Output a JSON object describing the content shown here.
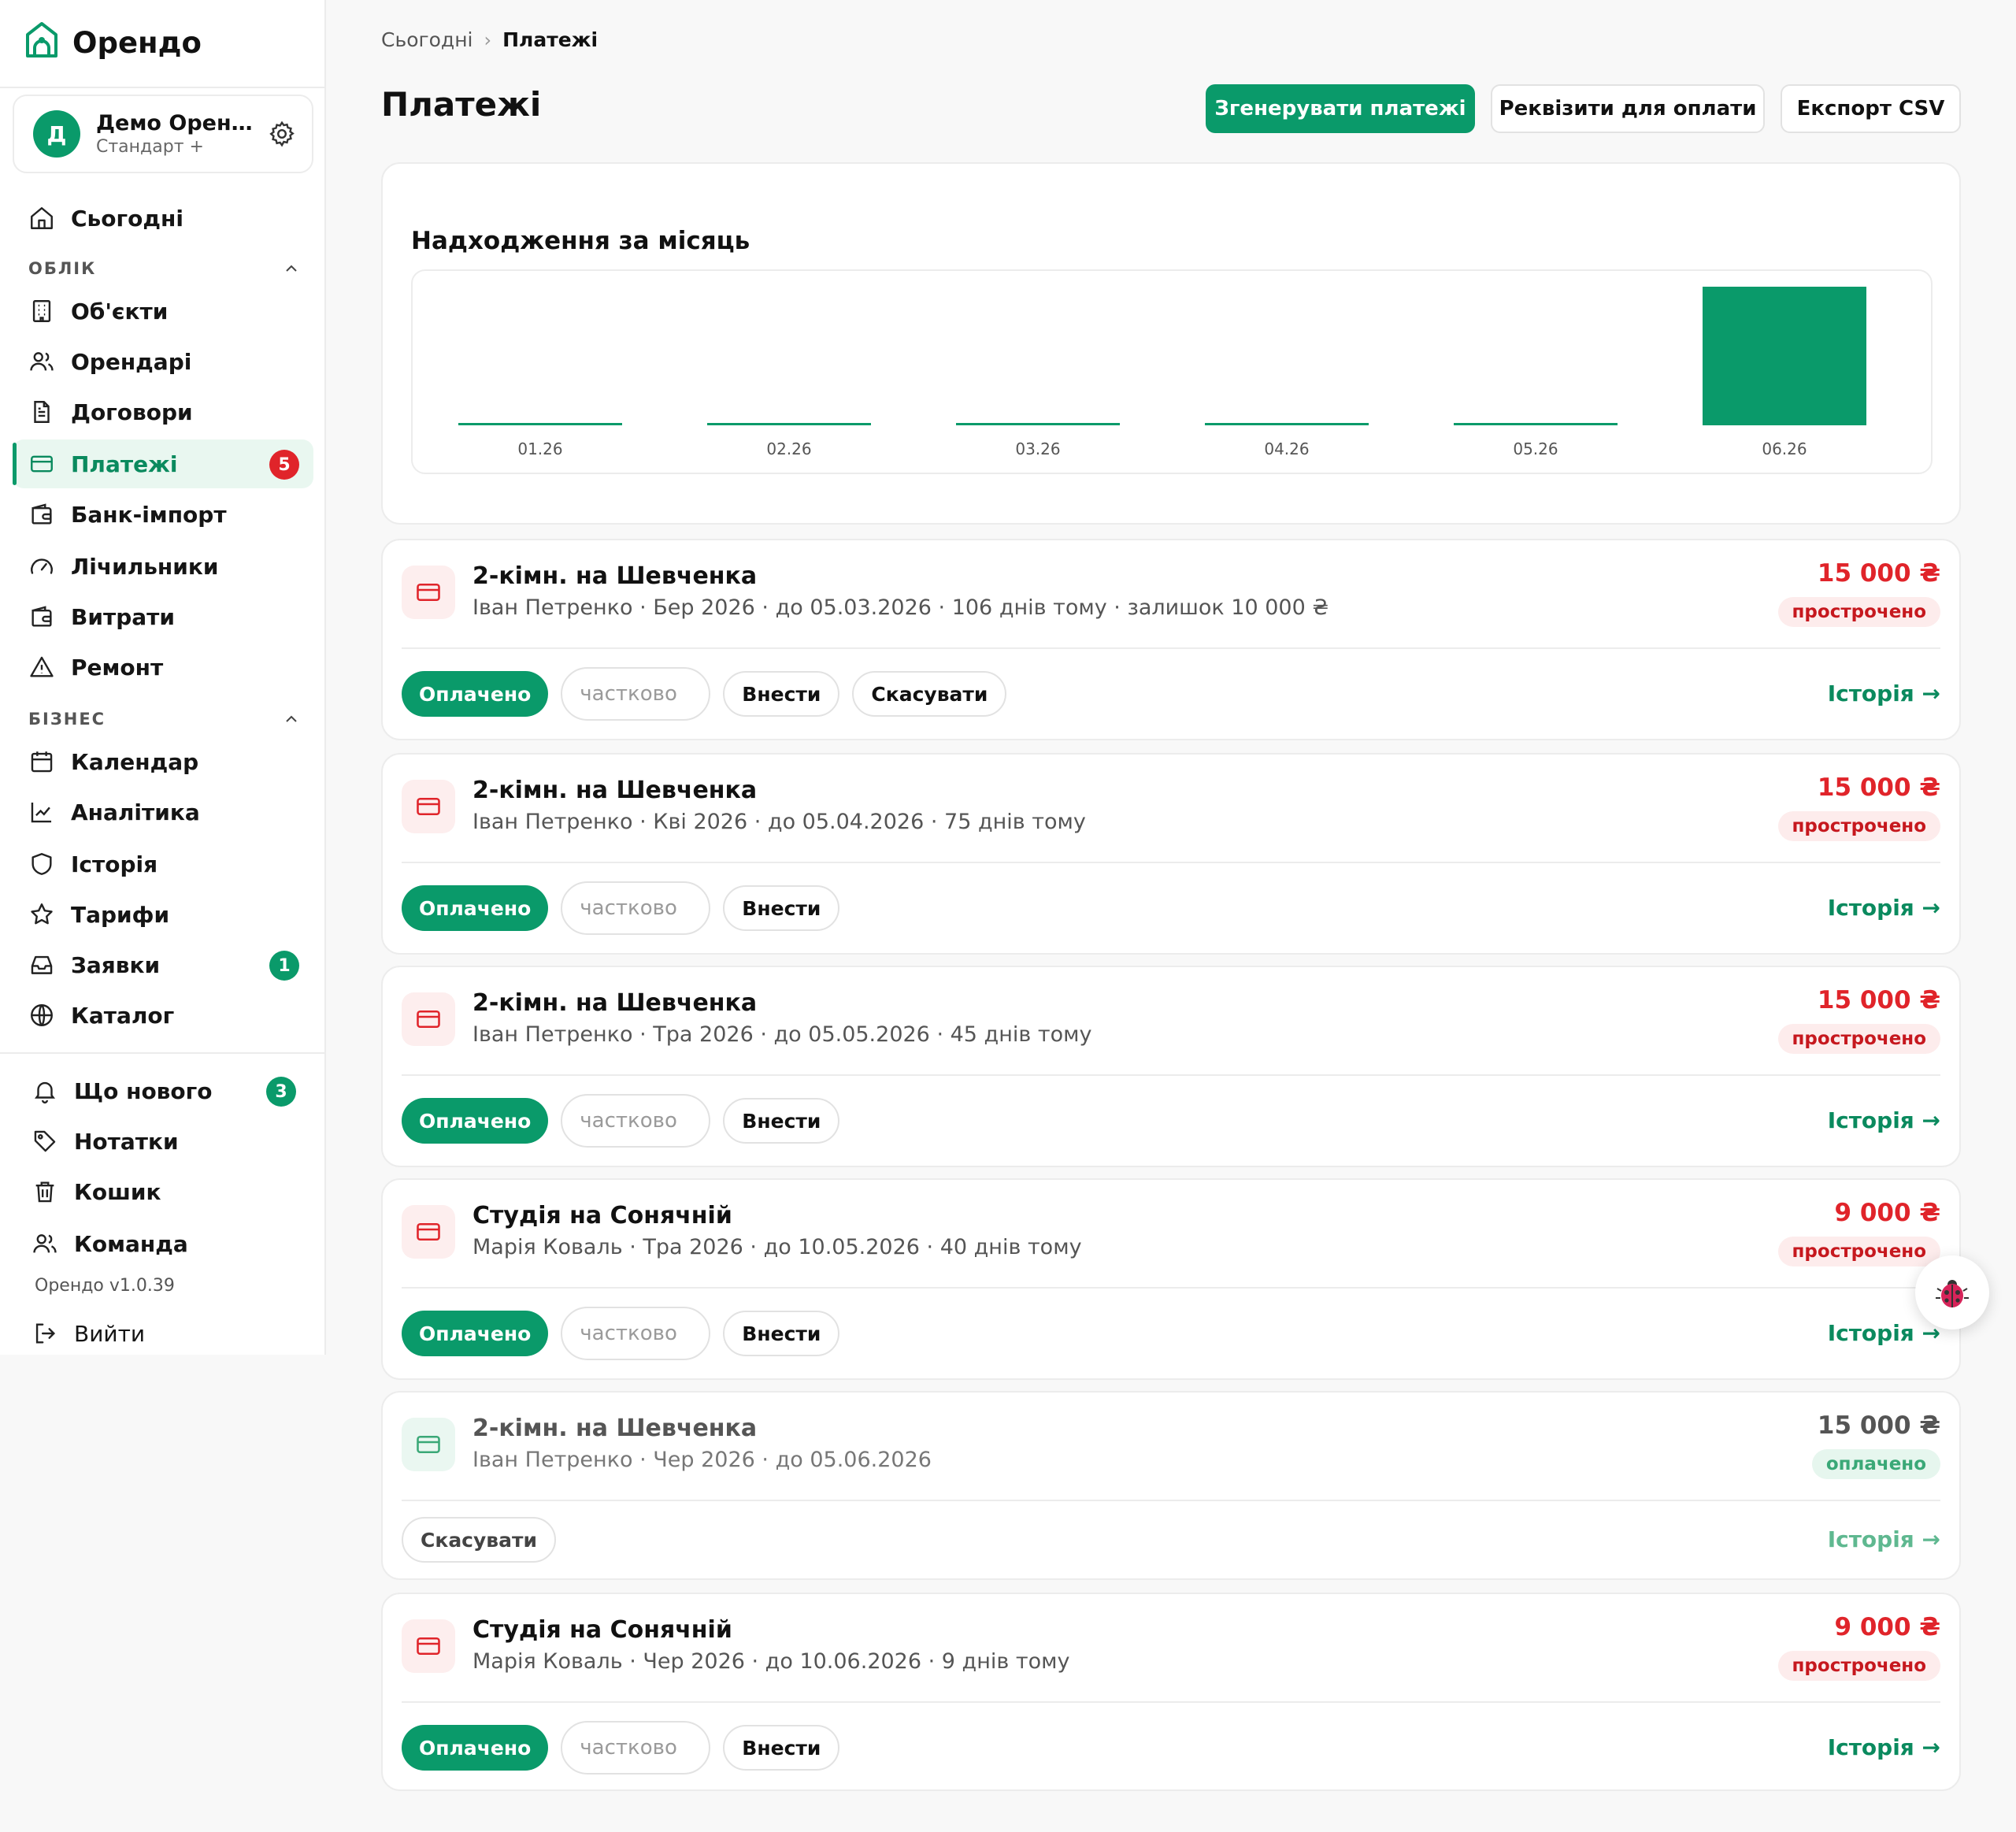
{
  "brand": {
    "name": "Орендо"
  },
  "workspace": {
    "avatar_letter": "Д",
    "name": "Демо Орендо",
    "plan": "Стандарт +"
  },
  "nav": {
    "top": [
      {
        "label": "Сьогодні",
        "icon": "home-icon"
      }
    ],
    "section_records": "ОБЛІК",
    "records": [
      {
        "label": "Об'єкти",
        "icon": "building-icon"
      },
      {
        "label": "Орендарі",
        "icon": "users-icon"
      },
      {
        "label": "Договори",
        "icon": "document-icon"
      },
      {
        "label": "Платежі",
        "icon": "card-icon",
        "badge": "5",
        "active": true
      },
      {
        "label": "Банк-імпорт",
        "icon": "wallet-icon"
      },
      {
        "label": "Лічильники",
        "icon": "gauge-icon"
      },
      {
        "label": "Витрати",
        "icon": "wallet-icon"
      },
      {
        "label": "Ремонт",
        "icon": "warning-icon"
      }
    ],
    "section_business": "БІЗНЕС",
    "business": [
      {
        "label": "Календар",
        "icon": "calendar-icon"
      },
      {
        "label": "Аналітика",
        "icon": "chart-line-icon"
      },
      {
        "label": "Історія",
        "icon": "shield-icon"
      },
      {
        "label": "Тарифи",
        "icon": "star-icon"
      },
      {
        "label": "Заявки",
        "icon": "inbox-icon",
        "badge": "1"
      },
      {
        "label": "Каталог",
        "icon": "globe-icon"
      }
    ],
    "bottom": [
      {
        "label": "Що нового",
        "icon": "bell-icon",
        "badge": "3"
      },
      {
        "label": "Нотатки",
        "icon": "tag-icon"
      },
      {
        "label": "Кошик",
        "icon": "trash-icon"
      },
      {
        "label": "Команда",
        "icon": "users-icon"
      }
    ],
    "version": "Орендо v1.0.39",
    "logout": {
      "label": "Вийти",
      "icon": "logout-icon"
    }
  },
  "breadcrumb": {
    "root": "Сьогодні",
    "separator": "›",
    "current": "Платежі"
  },
  "page": {
    "title": "Платежі"
  },
  "header_buttons": {
    "generate": "Згенерувати платежі",
    "requisites": "Реквізити для оплати",
    "export": "Експорт CSV"
  },
  "chart_data": {
    "type": "bar",
    "title": "Надходження за місяць",
    "categories": [
      "01.26",
      "02.26",
      "03.26",
      "04.26",
      "05.26",
      "06.26"
    ],
    "values": [
      0,
      0,
      0,
      0,
      0,
      15000
    ],
    "color": "#0a9a6a",
    "grid": false
  },
  "payments": [
    {
      "title": "2-кімн. на Шевченка",
      "subtitle": "Іван Петренко · Бер 2026 · до 05.03.2026 · 106 днів тому · залишок 10 000 ₴",
      "amount": "15 000 ₴",
      "status": "прострочено",
      "overdue": true,
      "actions": {
        "paid": "Оплачено",
        "partial_placeholder": "частково",
        "enter": "Внести",
        "cancel": "Скасувати"
      },
      "history": "Історія →"
    },
    {
      "title": "2-кімн. на Шевченка",
      "subtitle": "Іван Петренко · Кві 2026 · до 05.04.2026 · 75 днів тому",
      "amount": "15 000 ₴",
      "status": "прострочено",
      "overdue": true,
      "actions": {
        "paid": "Оплачено",
        "partial_placeholder": "частково",
        "enter": "Внести"
      },
      "history": "Історія →"
    },
    {
      "title": "2-кімн. на Шевченка",
      "subtitle": "Іван Петренко · Тра 2026 · до 05.05.2026 · 45 днів тому",
      "amount": "15 000 ₴",
      "status": "прострочено",
      "overdue": true,
      "actions": {
        "paid": "Оплачено",
        "partial_placeholder": "частково",
        "enter": "Внести"
      },
      "history": "Історія →"
    },
    {
      "title": "Студія на Сонячній",
      "subtitle": "Марія Коваль · Тра 2026 · до 10.05.2026 · 40 днів тому",
      "amount": "9 000 ₴",
      "status": "прострочено",
      "overdue": true,
      "actions": {
        "paid": "Оплачено",
        "partial_placeholder": "частково",
        "enter": "Внести"
      },
      "history": "Історія →"
    },
    {
      "title": "2-кімн. на Шевченка",
      "subtitle": "Іван Петренко · Чер 2026 · до 05.06.2026",
      "amount": "15 000 ₴",
      "status": "оплачено",
      "overdue": false,
      "actions": {
        "cancel": "Скасувати"
      },
      "history": "Історія →"
    },
    {
      "title": "Студія на Сонячній",
      "subtitle": "Марія Коваль · Чер 2026 · до 10.06.2026 · 9 днів тому",
      "amount": "9 000 ₴",
      "status": "прострочено",
      "overdue": true,
      "actions": {
        "paid": "Оплачено",
        "partial_placeholder": "частково",
        "enter": "Внести"
      },
      "history": "Історія →"
    }
  ],
  "colors": {
    "accent": "#0a9a6a",
    "danger": "#e0242a",
    "active_bg": "#e9f7f0"
  }
}
